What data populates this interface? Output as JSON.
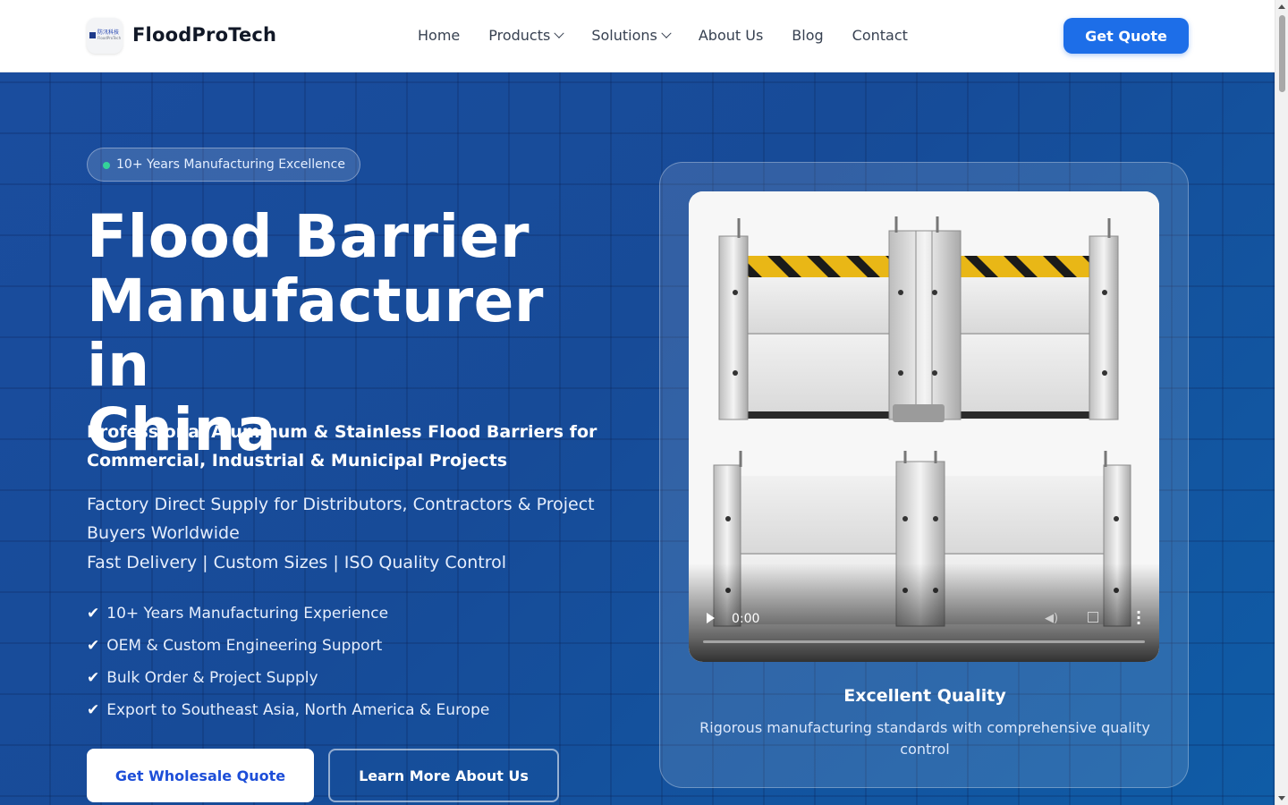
{
  "header": {
    "brand": "FloodProTech",
    "logo_text": "防汛科技",
    "logo_subtext": "FloodProTech",
    "nav": [
      {
        "label": "Home",
        "dropdown": false
      },
      {
        "label": "Products",
        "dropdown": true
      },
      {
        "label": "Solutions",
        "dropdown": true
      },
      {
        "label": "About Us",
        "dropdown": false
      },
      {
        "label": "Blog",
        "dropdown": false
      },
      {
        "label": "Contact",
        "dropdown": false
      }
    ],
    "cta": "Get Quote"
  },
  "hero": {
    "badge": "10+ Years Manufacturing Excellence",
    "title_lines": [
      "Flood Barrier",
      "Manufacturer in",
      "China"
    ],
    "subheading": "Professional Aluminum & Stainless Flood Barriers for Commercial, Industrial & Municipal Projects",
    "description": "Factory Direct Supply for Distributors, Contractors & Project Buyers Worldwide",
    "tagline": "Fast Delivery | Custom Sizes | ISO Quality Control",
    "features": [
      "10+ Years Manufacturing Experience",
      "OEM & Custom Engineering Support",
      "Bulk Order & Project Supply",
      "Export to Southeast Asia, North America & Europe"
    ],
    "primary_button": "Get Wholesale Quote",
    "secondary_button": "Learn More About Us"
  },
  "video": {
    "time": "0:00"
  },
  "card": {
    "title": "Excellent Quality",
    "description": "Rigorous manufacturing standards with comprehensive quality control"
  },
  "colors": {
    "primary": "#1d6ee8",
    "hero_bg": "#174b98",
    "badge_dot": "#34d399",
    "hazard_yellow": "#e9b716"
  }
}
